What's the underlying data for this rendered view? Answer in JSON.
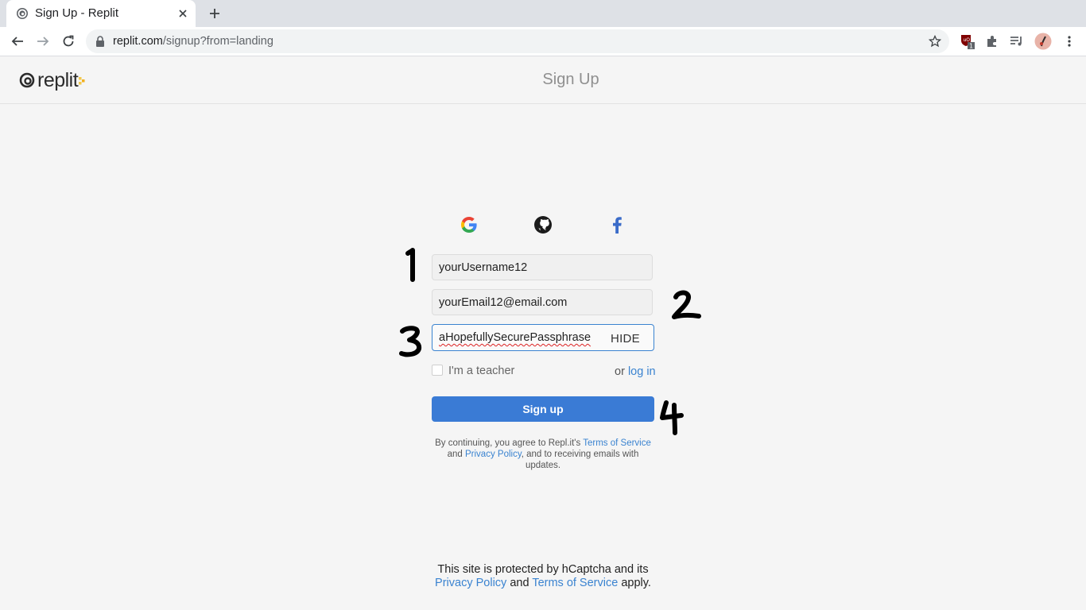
{
  "browser": {
    "tab_title": "Sign Up - Replit",
    "url_host": "replit.com",
    "url_path": "/signup?from=landing",
    "extension_badge": "1"
  },
  "header": {
    "logo_text": "replit",
    "title": "Sign Up"
  },
  "form": {
    "username_value": "yourUsername12",
    "email_value": "yourEmail12@email.com",
    "password_value": "aHopefullySecurePassphrase",
    "hide_label": "HIDE",
    "teacher_label": "I'm a teacher",
    "or_text": "or",
    "login_label": "log in",
    "signup_label": "Sign up"
  },
  "terms": {
    "prefix": "By continuing, you agree to Repl.it's",
    "terms_link": "Terms of Service",
    "and": "and",
    "privacy_link": "Privacy Policy",
    "suffix": ", and to receiving emails with updates."
  },
  "captcha": {
    "line1": "This site is protected by hCaptcha and its",
    "privacy_link": "Privacy Policy",
    "and": "and",
    "terms_link": "Terms of Service",
    "suffix": "apply."
  },
  "annotations": [
    "1",
    "2",
    "3",
    "4"
  ],
  "colors": {
    "accent": "#3a7bd5",
    "link": "#3a83d0",
    "page_bg": "#f5f5f5"
  }
}
